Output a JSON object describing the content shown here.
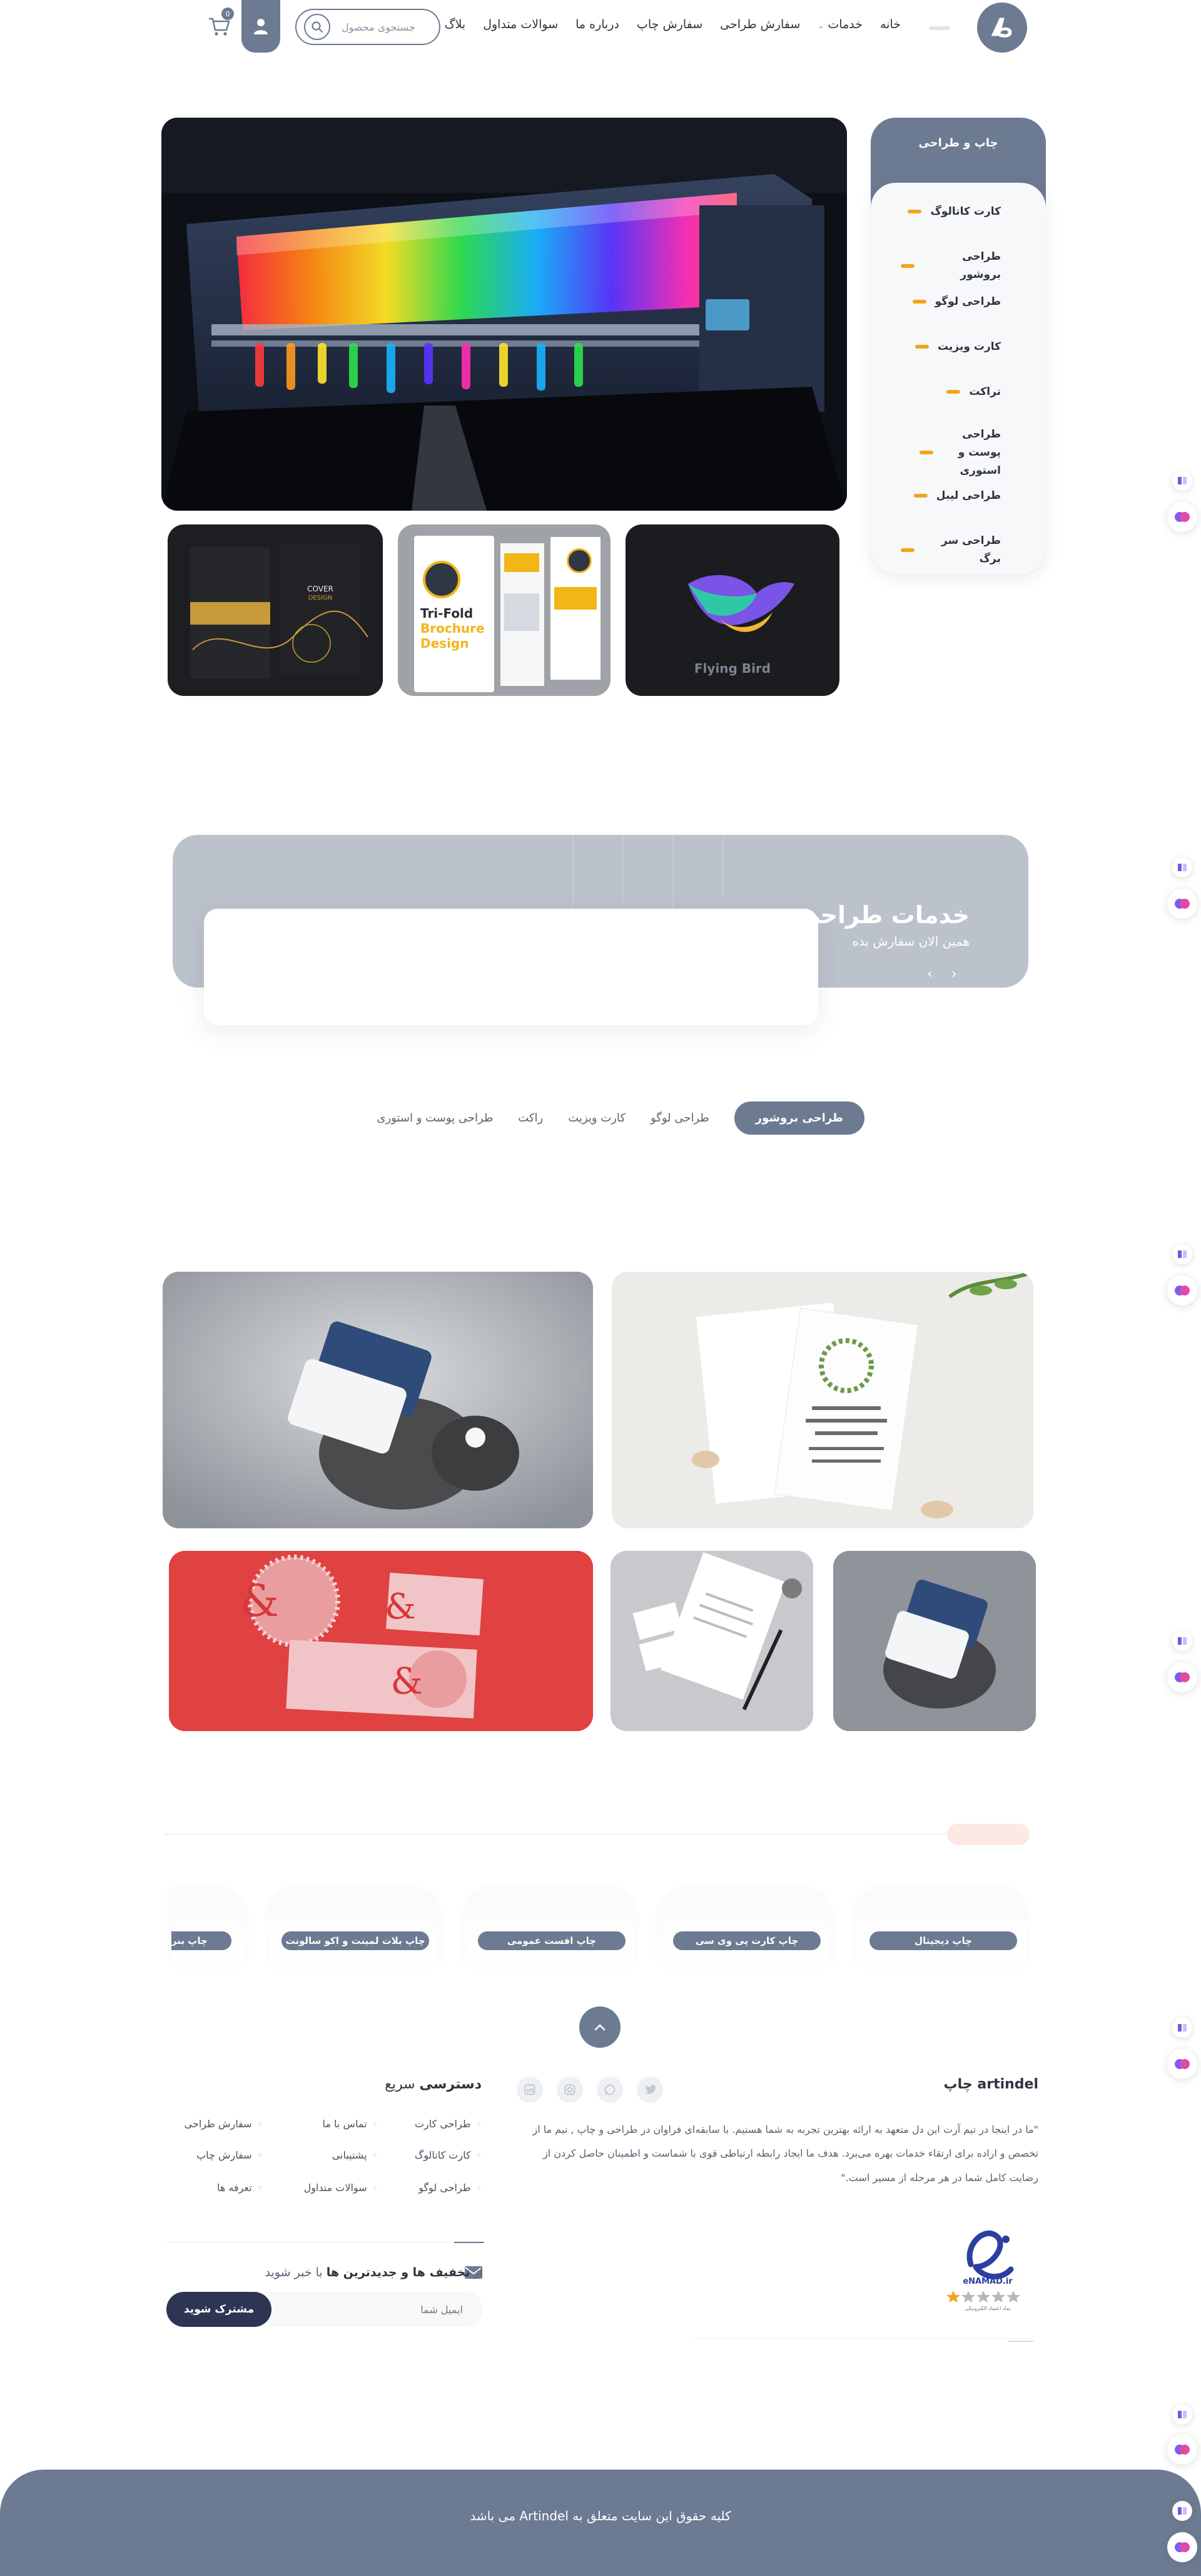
{
  "header": {
    "nav": [
      "خانه",
      "خدمات",
      "سفارش طراحی",
      "سفارش چاپ",
      "درباره ما",
      "سوالات متداول",
      "بلاگ"
    ],
    "search_placeholder": "جستجوی محصول",
    "cart_count": "0"
  },
  "hero": {
    "sidebar_title": "چاپ و طراحی",
    "sidebar_items": [
      "کارت کاتالوگ",
      "طراحی بروشور",
      "طراحی لوگو",
      "کارت ویزیت",
      "تراکت",
      "طراحی پوست و استوری",
      "طراحی لیبل",
      "طراحی سر برگ"
    ],
    "thumbs": {
      "brochure_title_1": "Tri-Fold",
      "brochure_title_2": "Brochure",
      "brochure_title_3": "Design",
      "logo_caption": "Flying Bird",
      "cover_label_1": "COVER",
      "cover_label_2": "DESIGN"
    }
  },
  "design_services": {
    "title": "خدمات طراحی",
    "subtitle": "همین الان سفارش بده"
  },
  "tabs": [
    "طراحی بروشور",
    "طراحی لوگو",
    "کارت ویزیت",
    "راکت",
    "طراحی پوست و استوری"
  ],
  "print_services": [
    "چاپ دیجیتال",
    "چاپ کارت پی وی سی",
    "چاپ افست عمومی",
    "چاپ بنر",
    "چاپ بلات لمینت و اکو سالونت"
  ],
  "footer": {
    "brand": "artindel چاپ",
    "about": "\"ما در اینجا در تیم آرت این دل متعهد به ارائه بهترین تجربه به شما هستیم. با سابقه‌ای فراوان در طراحی و چاپ , تیم ما از تخصص و اراده برای ارتقاء خدمات بهره می‌برد. هدف ما ایجاد رابطه ارتباطی قوی با شماست و اطمینان حاصل کردن از رضایت کامل شما در هر مرحله از مسیر است.\"",
    "quick_title_bold": "دسترسی",
    "quick_title_rest": "سریع",
    "quick_links": [
      [
        "طراحی کارت",
        "تماس با ما",
        "سفارش طراحی"
      ],
      [
        "کارت کاتالوگ",
        "پشتیبانی",
        "سفارش چاپ"
      ],
      [
        "طراحی لوگو",
        "سوالات متداول",
        "تعرفه ها"
      ]
    ],
    "newsletter_prefix": "از",
    "newsletter_bold": "تخفیف ها و جدیدترین ها",
    "newsletter_suffix": "با خبر شوید",
    "email_placeholder": "ایمیل شما",
    "subscribe_label": "مشترک شوید",
    "enamad_label": "eNAMAD.ir",
    "enamad_caption": "نماد اعتماد الکترونیکی",
    "copyright": "کلیه حقوق این سایت متعلق به Artindel می باشد"
  },
  "colors": {
    "primary": "#6c7a92",
    "accent": "#f2a51a",
    "dark_button": "#2d3553"
  }
}
